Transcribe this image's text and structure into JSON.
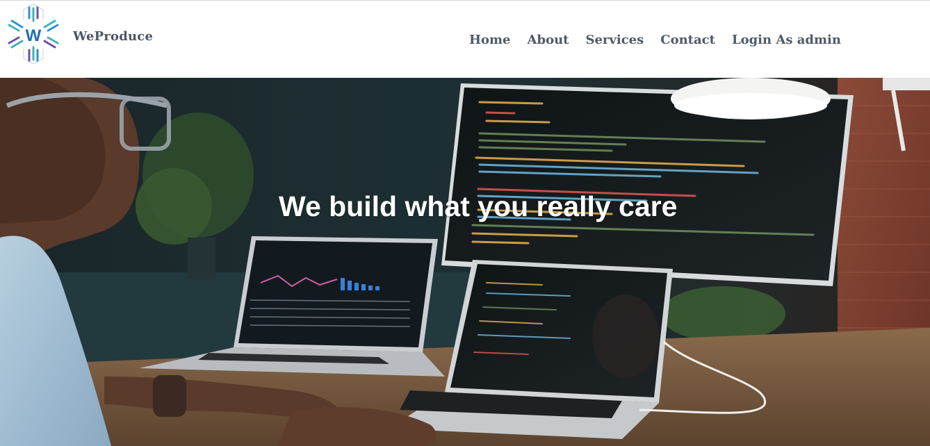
{
  "header": {
    "brand": "WeProduce",
    "logo_letter": "W",
    "nav": [
      {
        "label": "Home"
      },
      {
        "label": "About"
      },
      {
        "label": "Services"
      },
      {
        "label": "Contact"
      },
      {
        "label": "Login As admin"
      }
    ]
  },
  "hero": {
    "title": "We build what you really care",
    "image": "developer-at-desk-photo"
  },
  "colors": {
    "nav_text": "#4d5a6a",
    "brand_text": "#4b5666",
    "logo_accent": "#2f8fd6",
    "logo_teal": "#3fb3b0",
    "logo_purple": "#6a4fa3",
    "hero_text": "#ffffff"
  }
}
